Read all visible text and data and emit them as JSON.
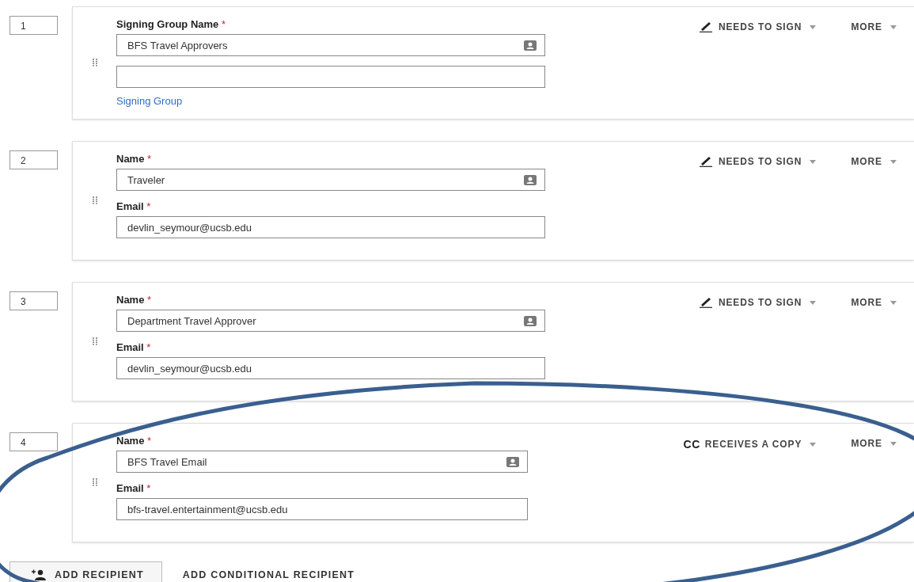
{
  "recipients": [
    {
      "number": "1",
      "fields": [
        {
          "kind": "contact",
          "label": "Signing Group Name",
          "required_mark": "*",
          "value": "BFS Travel Approvers"
        },
        {
          "kind": "blank"
        }
      ],
      "link": "Signing Group",
      "role": {
        "kind": "sign",
        "label": "NEEDS TO SIGN"
      },
      "more": "MORE"
    },
    {
      "number": "2",
      "fields": [
        {
          "kind": "contact",
          "label": "Name",
          "required_mark": "*",
          "value": "Traveler"
        },
        {
          "kind": "plain",
          "label": "Email",
          "required_mark": "*",
          "value": "devlin_seymour@ucsb.edu"
        }
      ],
      "role": {
        "kind": "sign",
        "label": "NEEDS TO SIGN"
      },
      "more": "MORE"
    },
    {
      "number": "3",
      "fields": [
        {
          "kind": "contact",
          "label": "Name",
          "required_mark": "*",
          "value": "Department Travel Approver"
        },
        {
          "kind": "plain",
          "label": "Email",
          "required_mark": "*",
          "value": "devlin_seymour@ucsb.edu"
        }
      ],
      "role": {
        "kind": "sign",
        "label": "NEEDS TO SIGN"
      },
      "more": "MORE"
    },
    {
      "number": "4",
      "fields": [
        {
          "kind": "contact",
          "label": "Name",
          "required_mark": "*",
          "value": "BFS Travel Email"
        },
        {
          "kind": "plain",
          "label": "Email",
          "required_mark": "*",
          "value": "bfs-travel.entertainment@ucsb.edu"
        }
      ],
      "role": {
        "kind": "cc",
        "badge": "CC",
        "label": "RECEIVES A COPY"
      },
      "more": "MORE"
    }
  ],
  "add_recipient": "ADD RECIPIENT",
  "add_conditional": "ADD CONDITIONAL RECIPIENT",
  "annotation": {
    "kind": "oval"
  }
}
